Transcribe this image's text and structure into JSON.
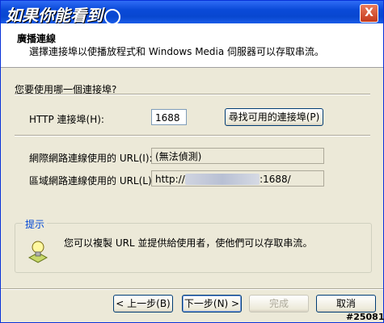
{
  "window": {
    "title": "如果你能看到",
    "close_label": "X"
  },
  "header": {
    "title": "廣播連線",
    "description": "選擇連接埠以使播放程式和 Windows Media 伺服器可以存取串流。"
  },
  "form": {
    "question": "您要使用哪一個連接埠?",
    "http_port_label": "HTTP 連接埠(H):",
    "http_port_value": "1688",
    "find_port_button": "尋找可用的連接埠(P)",
    "internet_url_label": "網際網路連線使用的 URL(I):",
    "internet_url_value": "(無法偵測)",
    "lan_url_label": "區域網路連線使用的 URL(L):",
    "lan_url_prefix": "http://",
    "lan_url_suffix": ":1688/"
  },
  "tip": {
    "title": "提示",
    "text": "您可以複製 URL 並提供給使用者，使他們可以存取串流。"
  },
  "buttons": {
    "back": "< 上一步(B)",
    "next": "下一步(N) >",
    "finish": "完成",
    "cancel": "取消"
  },
  "watermark": "#25081"
}
